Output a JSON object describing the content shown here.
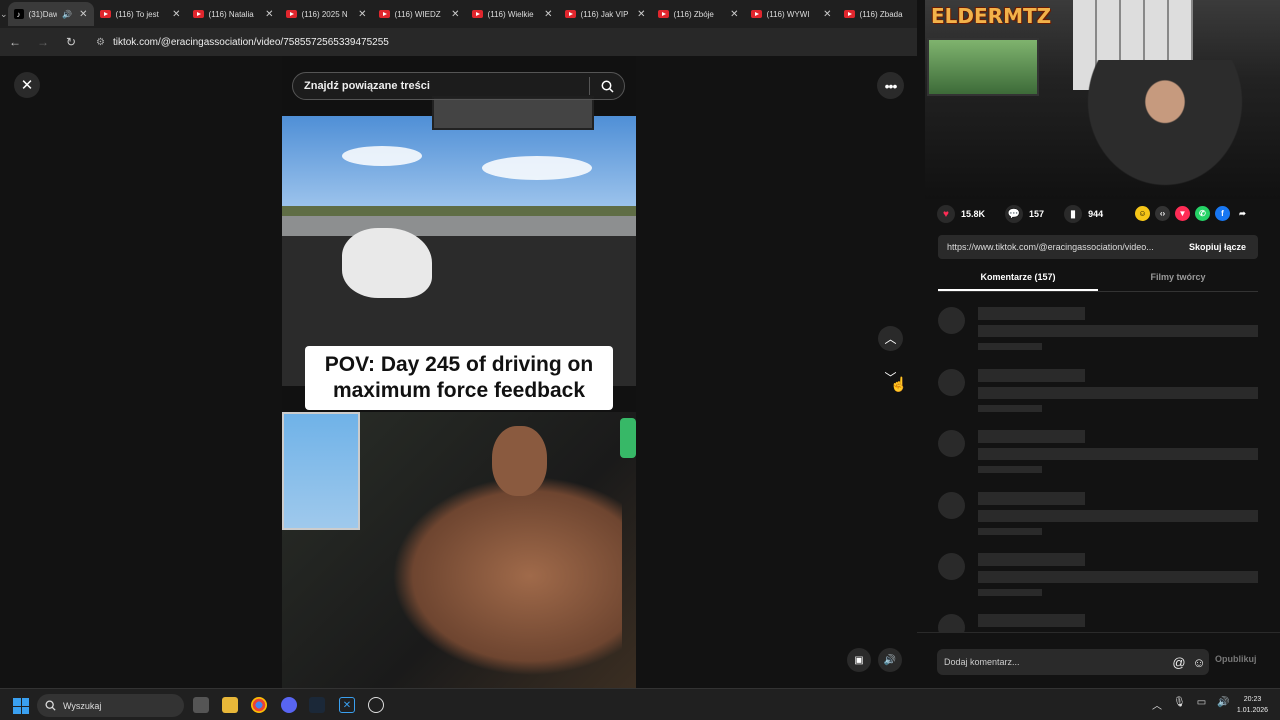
{
  "browser": {
    "tabs": [
      {
        "title": "(31)Daw",
        "favicon": "tiktok-icon",
        "active": true
      },
      {
        "title": "(116) To jest",
        "favicon": "youtube-icon"
      },
      {
        "title": "(116) Natalia",
        "favicon": "youtube-icon"
      },
      {
        "title": "(116) 2025 N",
        "favicon": "youtube-icon"
      },
      {
        "title": "(116) WIEDZ",
        "favicon": "youtube-icon"
      },
      {
        "title": "(116) Wielkie",
        "favicon": "youtube-icon"
      },
      {
        "title": "(116) Jak VIP",
        "favicon": "youtube-icon"
      },
      {
        "title": "(116) Zbóje",
        "favicon": "youtube-icon"
      },
      {
        "title": "(116) WYWI",
        "favicon": "youtube-icon"
      },
      {
        "title": "(116) Zbada",
        "favicon": "youtube-icon"
      }
    ],
    "url": "tiktok.com/@eracingassociation/video/7585572565339475255"
  },
  "video_page": {
    "search_placeholder": "Znajdź powiązane treści",
    "caption": "POV: Day 245 of driving on maximum force feedback"
  },
  "streamer": {
    "logo": "ELDERMTZ"
  },
  "side": {
    "likes": "15.8K",
    "comments": "157",
    "saves": "944",
    "link": "https://www.tiktok.com/@eracingassociation/video...",
    "copy_label": "Skopiuj łącze",
    "tab_comments": "Komentarze (157)",
    "tab_creator": "Filmy twórcy",
    "comment_placeholder": "Dodaj komentarz...",
    "post_label": "Opublikuj"
  },
  "taskbar": {
    "search_placeholder": "Wyszukaj",
    "time": "20:23",
    "date": "1.01.2026"
  },
  "colors": {
    "accent": "#fe2c55",
    "bg": "#121212"
  }
}
